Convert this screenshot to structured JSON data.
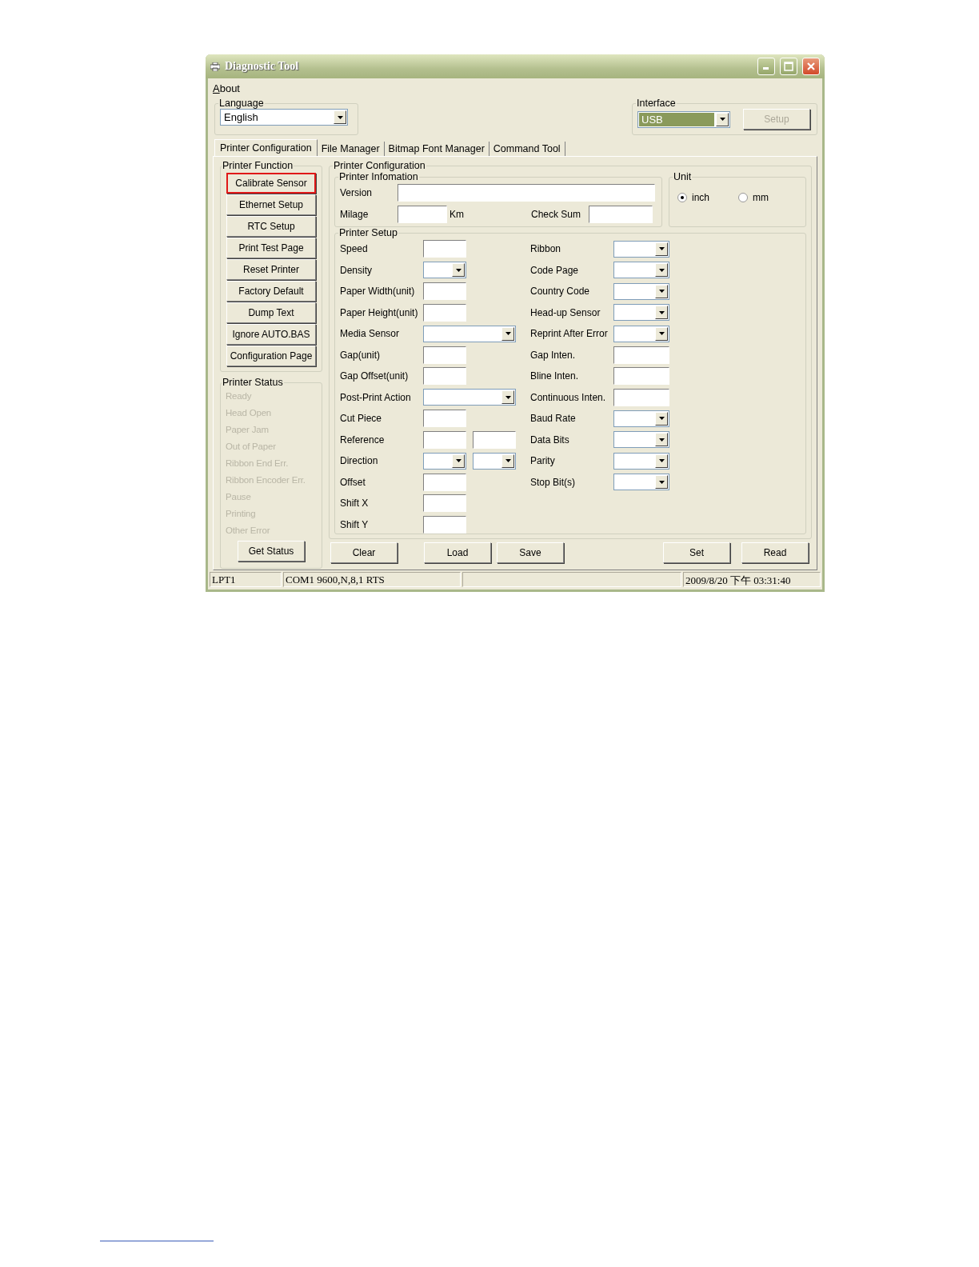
{
  "window": {
    "title": "Diagnostic Tool"
  },
  "menu": [
    {
      "label": "About"
    }
  ],
  "language": {
    "label": "Language",
    "value": "English"
  },
  "interface": {
    "label": "Interface",
    "value": "USB",
    "selected": true,
    "setup_button": {
      "label": "Setup",
      "disabled": true
    }
  },
  "tabs": [
    {
      "label": "Printer Configuration",
      "selected": true
    },
    {
      "label": "File Manager",
      "selected": false
    },
    {
      "label": "Bitmap Font Manager",
      "selected": false
    },
    {
      "label": "Command Tool",
      "selected": false
    }
  ],
  "printer_function": {
    "title": "Printer Function",
    "buttons": [
      {
        "label": "Calibrate Sensor",
        "highlighted": true
      },
      {
        "label": "Ethernet Setup",
        "highlighted": false
      },
      {
        "label": "RTC Setup",
        "highlighted": false
      },
      {
        "label": "Print Test Page",
        "highlighted": false
      },
      {
        "label": "Reset Printer",
        "highlighted": false
      },
      {
        "label": "Factory Default",
        "highlighted": false
      },
      {
        "label": "Dump Text",
        "highlighted": false
      },
      {
        "label": "Ignore AUTO.BAS",
        "highlighted": false
      },
      {
        "label": "Configuration Page",
        "highlighted": false
      }
    ]
  },
  "printer_status": {
    "title": "Printer Status",
    "items": [
      {
        "label": "Ready",
        "disabled": true
      },
      {
        "label": "Head Open",
        "disabled": true
      },
      {
        "label": "Paper Jam",
        "disabled": true
      },
      {
        "label": "Out of Paper",
        "disabled": true
      },
      {
        "label": "Ribbon End Err.",
        "disabled": true
      },
      {
        "label": "Ribbon Encoder Err.",
        "disabled": true
      },
      {
        "label": "Pause",
        "disabled": true
      },
      {
        "label": "Printing",
        "disabled": true
      },
      {
        "label": "Other Error",
        "disabled": true
      }
    ],
    "button": "Get Status"
  },
  "printer_configuration": {
    "title": "Printer Configuration",
    "information": {
      "title": "Printer Infomation",
      "version_label": "Version",
      "milage_label": "Milage",
      "milage_unit": "Km",
      "checksum_label": "Check Sum"
    },
    "unit": {
      "title": "Unit",
      "options": [
        {
          "label": "inch",
          "selected": true
        },
        {
          "label": "mm",
          "selected": false
        }
      ]
    },
    "setup": {
      "title": "Printer Setup",
      "left": [
        {
          "label": "Speed",
          "kind": "text"
        },
        {
          "label": "Density",
          "kind": "short-combo"
        },
        {
          "label": "Paper Width(unit)",
          "kind": "text"
        },
        {
          "label": "Paper Height(unit)",
          "kind": "text"
        },
        {
          "label": "Media Sensor",
          "kind": "wide-combo"
        },
        {
          "label": "Gap(unit)",
          "kind": "text"
        },
        {
          "label": "Gap Offset(unit)",
          "kind": "text"
        },
        {
          "label": "Post-Print Action",
          "kind": "wide-combo"
        },
        {
          "label": "Cut Piece",
          "kind": "text"
        },
        {
          "label": "Reference",
          "kind": "text-pair"
        },
        {
          "label": "Direction",
          "kind": "combo-pair"
        },
        {
          "label": "Offset",
          "kind": "text"
        },
        {
          "label": "Shift X",
          "kind": "text"
        },
        {
          "label": "Shift Y",
          "kind": "text"
        }
      ],
      "right": [
        {
          "label": "Ribbon",
          "kind": "combo"
        },
        {
          "label": "Code Page",
          "kind": "combo"
        },
        {
          "label": "Country Code",
          "kind": "combo"
        },
        {
          "label": "Head-up Sensor",
          "kind": "combo"
        },
        {
          "label": "Reprint After Error",
          "kind": "combo"
        },
        {
          "label": "Gap Inten.",
          "kind": "wtext"
        },
        {
          "label": "Bline Inten.",
          "kind": "wtext"
        },
        {
          "label": "Continuous Inten.",
          "kind": "wtext"
        },
        {
          "label": "Baud Rate",
          "kind": "combo"
        },
        {
          "label": "Data Bits",
          "kind": "combo"
        },
        {
          "label": "Parity",
          "kind": "combo"
        },
        {
          "label": "Stop Bit(s)",
          "kind": "combo"
        }
      ]
    },
    "buttons_left": [
      "Clear",
      "Load",
      "Save"
    ],
    "buttons_right": [
      "Set",
      "Read"
    ]
  },
  "status_bar": [
    {
      "text": "LPT1"
    },
    {
      "text": "COM1 9600,N,8,1 RTS"
    },
    {
      "text": "2009/8/20 下午 03:31:40"
    }
  ]
}
